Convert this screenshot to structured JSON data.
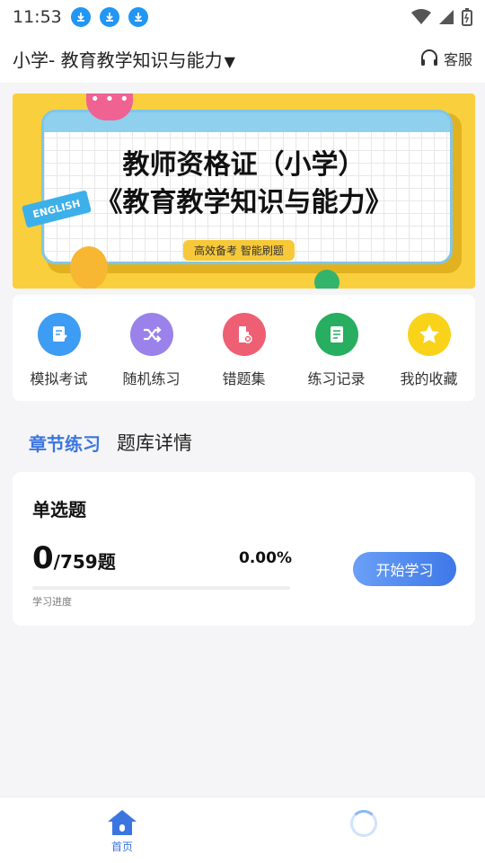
{
  "status_bar": {
    "time": "11:53"
  },
  "header": {
    "title": "小学- 教育教学知识与能力",
    "caret": "▼",
    "service_label": "客服"
  },
  "banner": {
    "line1": "教师资格证（小学）",
    "line2": "《教育教学知识与能力》",
    "tag": "高效备考  智能刷题",
    "badge": "ENGLISH"
  },
  "quick_actions": [
    {
      "label": "模拟考试",
      "icon": "exam-paper-icon",
      "color": "#3d9cf3"
    },
    {
      "label": "随机练习",
      "icon": "shuffle-icon",
      "color": "#9a82ea"
    },
    {
      "label": "错题集",
      "icon": "wrong-questions-icon",
      "color": "#ef5f73"
    },
    {
      "label": "练习记录",
      "icon": "record-icon",
      "color": "#27ae60"
    },
    {
      "label": "我的收藏",
      "icon": "star-icon",
      "color": "#f8d31a"
    }
  ],
  "tabs": {
    "chapter": "章节练习",
    "details": "题库详情"
  },
  "card": {
    "title": "单选题",
    "done": "0",
    "total": "/759题",
    "percent": "0.00%",
    "progress_fraction": 0,
    "progress_label": "学习进度",
    "button": "开始学习"
  },
  "bottom_nav": {
    "home_label": "首页"
  },
  "colors": {
    "accent": "#3b76e0"
  }
}
